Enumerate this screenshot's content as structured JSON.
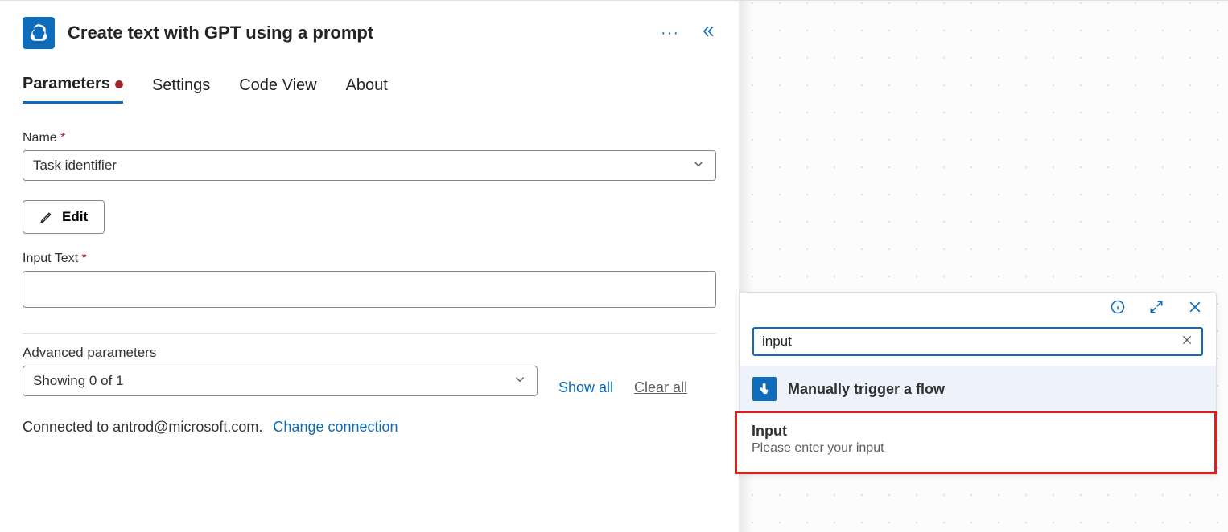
{
  "header": {
    "title": "Create text with GPT using a prompt"
  },
  "tabs": {
    "parameters": "Parameters",
    "settings": "Settings",
    "codeview": "Code View",
    "about": "About"
  },
  "fields": {
    "name_label": "Name",
    "name_value": "Task identifier",
    "edit_label": "Edit",
    "input_text_label": "Input Text",
    "input_text_value": ""
  },
  "advanced": {
    "label": "Advanced parameters",
    "showing": "Showing 0 of 1",
    "show_all": "Show all",
    "clear_all": "Clear all"
  },
  "connection": {
    "prefix": "Connected to ",
    "account": "antrod@microsoft.com.",
    "change": "Change connection"
  },
  "popup": {
    "search_value": "input",
    "section_title": "Manually trigger a flow",
    "result_title": "Input",
    "result_sub": "Please enter your input"
  }
}
